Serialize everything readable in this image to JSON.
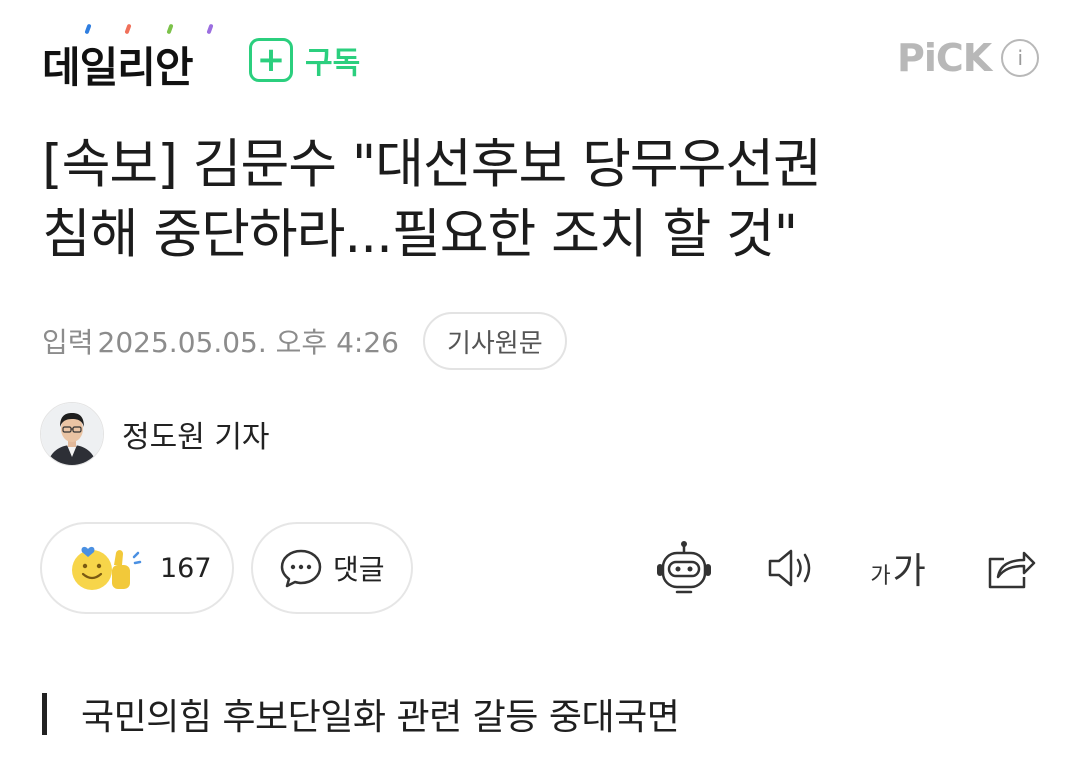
{
  "header": {
    "logo_text": "데일리안",
    "subscribe_label": "구독",
    "pick_label": "PiCK",
    "info_glyph": "i",
    "logo_dot_colors": [
      "#2f7ee0",
      "#f0705a",
      "#7cc24a",
      "#9b6ee0"
    ]
  },
  "article": {
    "title_line1": "[속보] 김문수 \"대선후보 당무우선권",
    "title_line2": "침해 중단하라...필요한 조치 할 것\"",
    "meta_label": "입력",
    "date": "2025.05.05. 오후 4:26",
    "original_button": "기사원문",
    "reporter_name": "정도원 기자",
    "subtitle": "국민의힘 후보단일화 관련 갈등 중대국면"
  },
  "actions": {
    "reaction_count": "167",
    "comment_label": "댓글",
    "font_small": "가",
    "font_large": "가"
  },
  "colors": {
    "accent_green": "#2bcf7e",
    "pick_gray": "#b8b8b8",
    "meta_gray": "#8c8c8c"
  },
  "icons": {
    "subscribe": "plus-icon",
    "info": "info-icon",
    "reaction": "smile-thumbs-up-icon",
    "comment": "speech-bubble-icon",
    "summary": "robot-icon",
    "tts": "speaker-icon",
    "font_size": "font-size-icon",
    "share": "share-icon"
  }
}
